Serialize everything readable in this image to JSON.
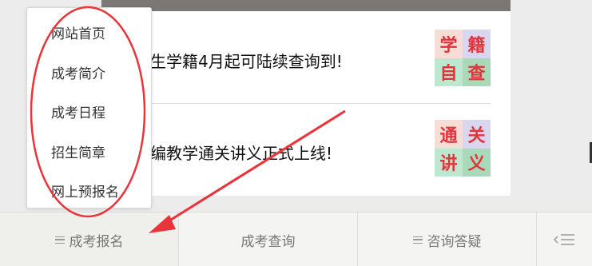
{
  "menu": {
    "items": [
      {
        "label": "网站首页"
      },
      {
        "label": "成考简介"
      },
      {
        "label": "成考日程"
      },
      {
        "label": "招生简章"
      },
      {
        "label": "网上预报名"
      }
    ]
  },
  "news": [
    {
      "title": "生学籍4月起可陆续查询到!",
      "badge": [
        "学",
        "籍",
        "自",
        "查"
      ]
    },
    {
      "title": "编教学通关讲义正式上线!",
      "badge": [
        "通",
        "关",
        "讲",
        "义"
      ]
    }
  ],
  "bottom_nav": {
    "tabs": [
      {
        "label": "成考报名",
        "icon": "menu-icon"
      },
      {
        "label": "成考查询"
      },
      {
        "label": "咨询答疑",
        "icon": "menu-icon"
      }
    ],
    "more_icon": "list-back-icon"
  },
  "colors": {
    "annotation_red": "#e8343a",
    "badge_text": "#e0353b"
  }
}
